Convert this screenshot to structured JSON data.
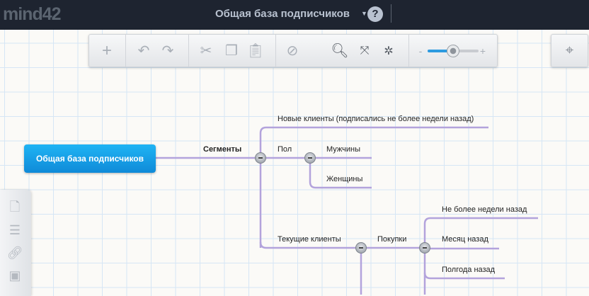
{
  "header": {
    "logo": "mind42",
    "title": "Общая база подписчиков",
    "help": "?"
  },
  "toolbar": {
    "zoom_level": 0.5
  },
  "map": {
    "root": "Общая база подписчиков",
    "segments": "Сегменты",
    "new_clients": "Новые клиенты (подписались не более недели назад)",
    "gender": "Пол",
    "men": "Мужчины",
    "women": "Женщины",
    "current_clients": "Текущие клиенты",
    "purchases": "Покупки",
    "week": "Не более недели назад",
    "month": "Месяц назад",
    "halfyear": "Полгода назад"
  },
  "colors": {
    "connector": "#b3a3dc",
    "root": "#1a9fe8",
    "header": "#1e2430"
  }
}
